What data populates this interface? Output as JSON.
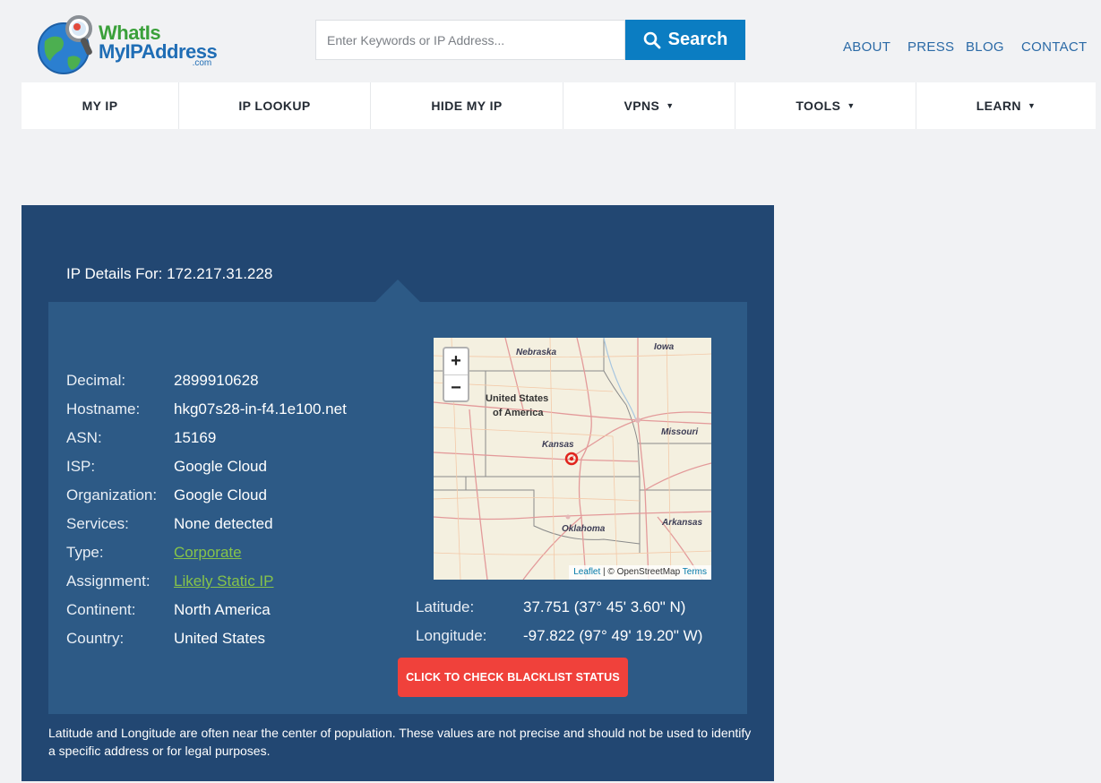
{
  "logo": {
    "line1": "WhatIs",
    "line2": "MyIPAddress",
    "line3": ".com"
  },
  "search": {
    "placeholder": "Enter Keywords or IP Address...",
    "button_label": "Search",
    "icon": "search-icon"
  },
  "top_links": [
    "ABOUT",
    "PRESS",
    "BLOG",
    "CONTACT"
  ],
  "nav": [
    {
      "label": "MY IP",
      "dropdown": false
    },
    {
      "label": "IP LOOKUP",
      "dropdown": false
    },
    {
      "label": "HIDE MY IP",
      "dropdown": false
    },
    {
      "label": "VPNS",
      "dropdown": true
    },
    {
      "label": "TOOLS",
      "dropdown": true
    },
    {
      "label": "LEARN",
      "dropdown": true
    }
  ],
  "caret": "▼",
  "panel": {
    "title": "IP Details For: 172.217.31.228",
    "details": [
      {
        "label": "Decimal:",
        "value": "2899910628",
        "link": false
      },
      {
        "label": "Hostname:",
        "value": "hkg07s28-in-f4.1e100.net",
        "link": false
      },
      {
        "label": "ASN:",
        "value": "15169",
        "link": false
      },
      {
        "label": "ISP:",
        "value": "Google Cloud",
        "link": false
      },
      {
        "label": "Organization:",
        "value": "Google Cloud",
        "link": false
      },
      {
        "label": "Services:",
        "value": "None detected",
        "link": false
      },
      {
        "label": "Type:",
        "value": "Corporate",
        "link": true
      },
      {
        "label": "Assignment:",
        "value": "Likely Static IP",
        "link": true
      },
      {
        "label": "Continent:",
        "value": "North America",
        "link": false
      },
      {
        "label": "Country:",
        "value": "United States",
        "link": false
      }
    ],
    "latitude": {
      "label": "Latitude:",
      "value": "37.751  (37° 45' 3.60\" N)"
    },
    "longitude": {
      "label": "Longitude:",
      "value": "-97.822  (97° 49' 19.20\" W)"
    },
    "blacklist_button": "CLICK TO CHECK BLACKLIST STATUS",
    "disclaimer": "Latitude and Longitude are often near the center of population. These values are not precise and should not be used to identify a specific address or for legal purposes."
  },
  "map": {
    "zoom_in": "+",
    "zoom_out": "−",
    "labels": {
      "nebraska": "Nebraska",
      "iowa": "Iowa",
      "usa_line1": "United States",
      "usa_line2": "of America",
      "kansas": "Kansas",
      "missouri": "Missouri",
      "oklahoma": "Oklahoma",
      "arkansas": "Arkansas"
    },
    "attribution": {
      "leaflet": "Leaflet",
      "separator": " | © OpenStreetMap ",
      "terms": "Terms"
    },
    "colors": {
      "land": "#f4f0e0",
      "roads": "#e8a0a0",
      "borders": "#8a8a8a",
      "marker": "#e0231c"
    }
  },
  "colors": {
    "page_bg": "#f1f2f4",
    "search_button": "#0b7dc2",
    "top_links": "#2b6aa6",
    "panel_outer": "#224772",
    "panel_inner": "#2d5a86",
    "link_green": "#86c34a",
    "blacklist_button": "#f0413b"
  }
}
